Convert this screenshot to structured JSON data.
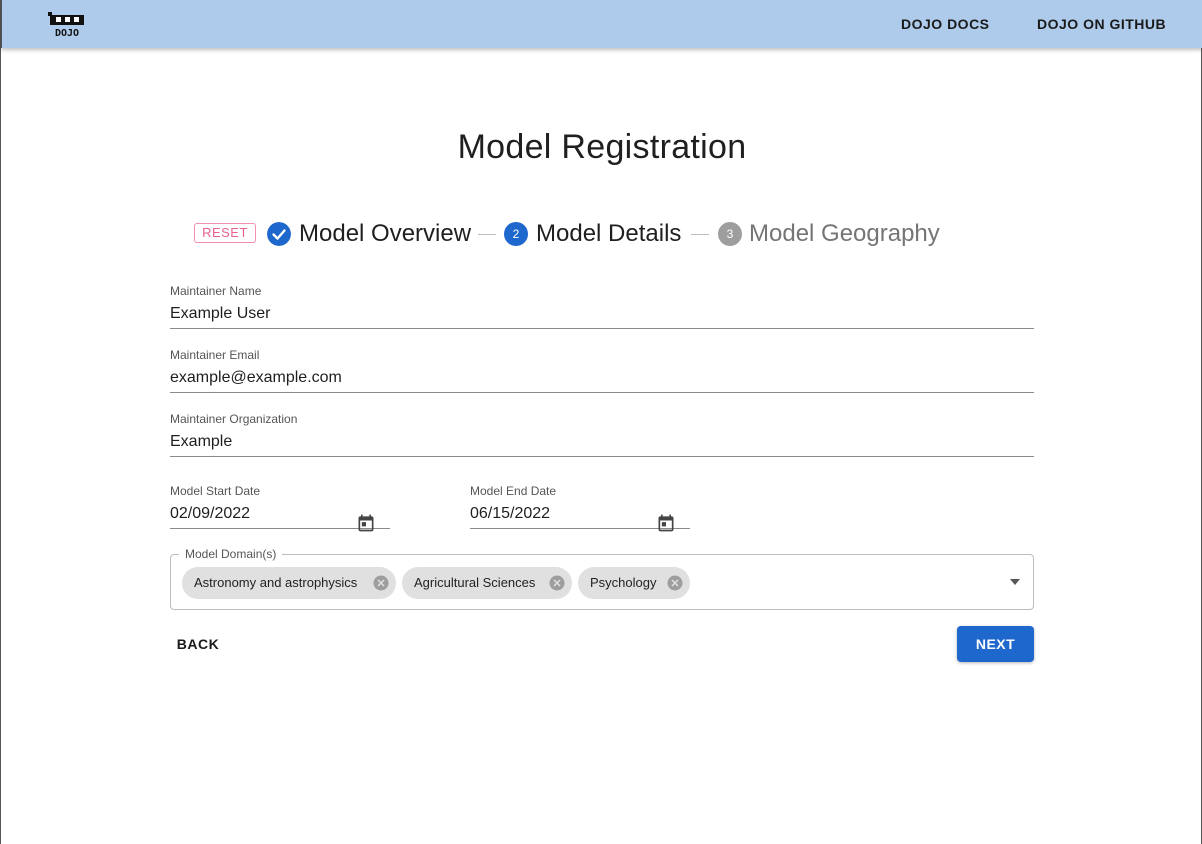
{
  "header": {
    "logo_icon": "dojo-logo-icon",
    "nav": [
      "DOJO DOCS",
      "DOJO ON GITHUB"
    ]
  },
  "page": {
    "title": "Model Registration"
  },
  "stepper": {
    "reset_label": "RESET",
    "steps": [
      {
        "label": "Model Overview",
        "state": "completed",
        "icon": "check-circle-icon"
      },
      {
        "label": "Model Details",
        "state": "active",
        "number": "2"
      },
      {
        "label": "Model Geography",
        "state": "pending",
        "number": "3"
      }
    ]
  },
  "form": {
    "maintainer_name": {
      "label": "Maintainer Name",
      "value": "Example User"
    },
    "maintainer_email": {
      "label": "Maintainer Email",
      "value": "example@example.com"
    },
    "maintainer_org": {
      "label": "Maintainer Organization",
      "value": "Example"
    },
    "start_date": {
      "label": "Model Start Date",
      "value": "02/09/2022",
      "icon": "calendar-icon"
    },
    "end_date": {
      "label": "Model End Date",
      "value": "06/15/2022",
      "icon": "calendar-icon"
    },
    "domains": {
      "label": "Model Domain(s)",
      "chips": [
        "Astronomy and astrophysics",
        "Agricultural Sciences",
        "Psychology"
      ],
      "icon": "chevron-down-icon"
    }
  },
  "actions": {
    "back_label": "BACK",
    "next_label": "NEXT"
  },
  "colors": {
    "appbar": "#aecbeb",
    "primary": "#1e67cc",
    "reset": "#e8628f",
    "pending": "#9e9e9e"
  }
}
